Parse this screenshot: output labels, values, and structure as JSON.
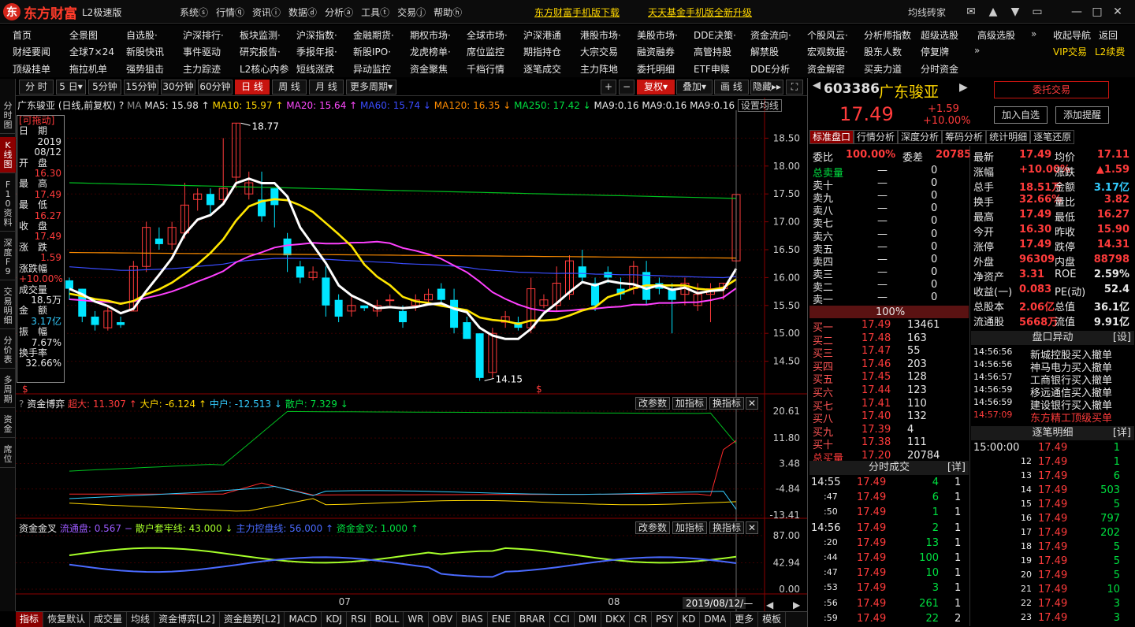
{
  "app": {
    "logo": "东方财富",
    "edition": "L2极速版",
    "menu": [
      "系统ⓢ",
      "行情ⓠ",
      "资讯ⓘ",
      "数据ⓓ",
      "分析ⓐ",
      "工具ⓣ",
      "交易ⓙ",
      "帮助ⓗ"
    ],
    "promo1": "东方财富手机版下载",
    "promo2": "天天基金手机版全新升级",
    "user": "均线砖家"
  },
  "menubar": {
    "row1": [
      "首页",
      "全景图",
      "自选股·",
      "沪深排行·",
      "板块监测·",
      "沪深指数·",
      "金融期货·",
      "期权市场·",
      "全球市场·",
      "沪深港通",
      "港股市场·",
      "美股市场·",
      "DDE决策·",
      "资金流向·",
      "个股风云·",
      "分析师指数",
      "超级选股",
      "高级选股"
    ],
    "row2": [
      "财经要闻",
      "全球7×24",
      "新股快讯",
      "事件驱动",
      "研究报告·",
      "季报年报·",
      "新股IPO·",
      "龙虎榜单·",
      "席位监控",
      "期指持仓",
      "大宗交易",
      "融资融券",
      "高管持股",
      "解禁股",
      "宏观数据·",
      "股东人数",
      "停复牌"
    ],
    "row3": [
      "顶级挂单",
      "拖拉机单",
      "强势狙击",
      "主力踪迹",
      "L2核心内参",
      "短线涨跌",
      "异动监控",
      "资金聚焦",
      "千档行情",
      "逐笔成交",
      "主力阵地",
      "委托明细",
      "ETF申赎",
      "DDE分析",
      "资金解密",
      "买卖力道",
      "分时资金"
    ],
    "right1": [
      "收起导航",
      "返回"
    ],
    "right2": [
      "VIP交易",
      "L2续费"
    ]
  },
  "lefttabs": [
    "分时图",
    "K线图",
    "F10资料",
    "深度F9",
    "交易明细",
    "分价表",
    "多周期",
    "资金",
    "席位"
  ],
  "periods": [
    "分 时",
    "5 日▾",
    "5分钟",
    "15分钟",
    "30分钟",
    "60分钟",
    "日 线",
    "周 线",
    "月 线",
    "更多周期▾"
  ],
  "chart_tools": {
    "plus": "+",
    "minus": "−",
    "fq": "复权▾",
    "overlay": "叠加▾",
    "grid": "画 线",
    "hide": "隐藏▸▸",
    "expand": "⛶"
  },
  "main_legend": {
    "name": "广东骏亚 (日线,前复权)",
    "q": "?",
    "ma": "MA",
    "ma5": "MA5: 15.98 ↑",
    "ma10": "MA10: 15.97 ↑",
    "ma20": "MA20: 15.64 ↑",
    "ma60": "MA60: 15.74 ↓",
    "ma120": "MA120: 16.35 ↓",
    "ma250": "MA250: 17.42 ↓",
    "ma9a": "MA9:0.16",
    "ma9b": "MA9:0.16",
    "ma9c": "MA9:0.16",
    "setting": "设置均线"
  },
  "datawin": {
    "drag": "[可拖动]",
    "date_l": "日　期",
    "date": "2019",
    "date2": "08/12",
    "open_l": "开　盘",
    "open": "16.30",
    "high_l": "最　高",
    "high": "17.49",
    "low_l": "最　低",
    "low": "16.27",
    "close_l": "收　盘",
    "close": "17.49",
    "chg_l": "涨　跌",
    "chg": "1.59",
    "pct_l": "涨跌幅",
    "pct": "+10.00%",
    "vol_l": "成交量",
    "vol": "18.5万",
    "amt_l": "金　额",
    "amt": "3.17亿",
    "amp_l": "振　幅",
    "amp": "7.67%",
    "turn_l": "换手率",
    "turn": "32.66%"
  },
  "price_axis": [
    "18.50",
    "18.00",
    "17.50",
    "17.00",
    "16.50",
    "16.00",
    "15.50",
    "15.00",
    "14.50"
  ],
  "annot": {
    "high": "18.77",
    "low": "14.15"
  },
  "sub1": {
    "title": "资金博弈",
    "q": "?",
    "big": "超大: 11.307 ↑",
    "large": "大户: -6.124 ↑",
    "mid": "中户: -12.513 ↓",
    "small": "散户: 7.329 ↓",
    "axis": [
      "20.61",
      "11.80",
      "3.48",
      "-4.84",
      "-13.41"
    ]
  },
  "sub2": {
    "title": "资金金叉",
    "flow": "流通盘: 0.567 −",
    "trap": "散户套牢线: 43.000 ↓",
    "ctrl": "主力控盘线: 56.000 ↑",
    "cross": "资金金叉: 1.000 ↑",
    "axis": [
      "87.00",
      "42.94",
      "0.00"
    ]
  },
  "sub_btns": [
    "改参数",
    "加指标",
    "换指标"
  ],
  "xaxis": {
    "m1": "07",
    "m2": "08",
    "date": "2019/08/12/—"
  },
  "bottom_tabs": [
    "指标",
    "恢复默认",
    "成交量",
    "均线",
    "资金博弈[L2]",
    "资金趋势[L2]",
    "MACD",
    "KDJ",
    "RSI",
    "BOLL",
    "WR",
    "OBV",
    "BIAS",
    "ENE",
    "BRAR",
    "CCI",
    "DMI",
    "DKX",
    "CR",
    "PSY",
    "KD",
    "DMA",
    "更多",
    "模板"
  ],
  "quote": {
    "code": "603386",
    "name": "广东骏亚",
    "price": "17.49",
    "chg": "+1.59",
    "pct": "+10.00%",
    "trade": "委托交易",
    "add": "加入自选",
    "alert": "添加提醒"
  },
  "quote_tabs": [
    "标准盘口",
    "行情分析",
    "深度分析",
    "筹码分析",
    "统计明细",
    "逐笔还原"
  ],
  "weibi": {
    "l": "委比",
    "v": "100.00%",
    "l2": "委差",
    "v2": "20785"
  },
  "asks": [
    {
      "l": "总卖量",
      "p": "—",
      "v": "0"
    },
    {
      "l": "卖十",
      "p": "—",
      "v": "0"
    },
    {
      "l": "卖九",
      "p": "—",
      "v": "0"
    },
    {
      "l": "卖八",
      "p": "—",
      "v": "0"
    },
    {
      "l": "卖七",
      "p": "—",
      "v": "0"
    },
    {
      "l": "卖六",
      "p": "—",
      "v": "0"
    },
    {
      "l": "卖五",
      "p": "—",
      "v": "0"
    },
    {
      "l": "卖四",
      "p": "—",
      "v": "0"
    },
    {
      "l": "卖三",
      "p": "—",
      "v": "0"
    },
    {
      "l": "卖二",
      "p": "—",
      "v": "0"
    },
    {
      "l": "卖一",
      "p": "—",
      "v": "0"
    }
  ],
  "ratio": "100%",
  "bids": [
    {
      "l": "买一",
      "p": "17.49",
      "v": "13461"
    },
    {
      "l": "买二",
      "p": "17.48",
      "v": "163"
    },
    {
      "l": "买三",
      "p": "17.47",
      "v": "55"
    },
    {
      "l": "买四",
      "p": "17.46",
      "v": "203"
    },
    {
      "l": "买五",
      "p": "17.45",
      "v": "128"
    },
    {
      "l": "买六",
      "p": "17.44",
      "v": "123"
    },
    {
      "l": "买七",
      "p": "17.41",
      "v": "110"
    },
    {
      "l": "买八",
      "p": "17.40",
      "v": "132"
    },
    {
      "l": "买九",
      "p": "17.39",
      "v": "4"
    },
    {
      "l": "买十",
      "p": "17.38",
      "v": "111"
    },
    {
      "l": "总买量",
      "p": "17.20",
      "v": "20784"
    }
  ],
  "stats": [
    [
      "最新",
      "17.49",
      "均价",
      "17.11"
    ],
    [
      "涨幅",
      "+10.00%",
      "涨跌",
      "▲1.59"
    ],
    [
      "总手",
      "18.51万",
      "金额",
      "3.17亿"
    ],
    [
      "换手",
      "32.66%",
      "量比",
      "3.82"
    ],
    [
      "最高",
      "17.49",
      "最低",
      "16.27"
    ],
    [
      "今开",
      "16.30",
      "昨收",
      "15.90"
    ],
    [
      "涨停",
      "17.49",
      "跌停",
      "14.31"
    ],
    [
      "外盘",
      "96309",
      "内盘",
      "88798"
    ],
    [
      "净资产",
      "3.31",
      "ROE",
      "2.59%"
    ],
    [
      "收益(一)",
      "0.083",
      "PE(动)",
      "52.4"
    ],
    [
      "总股本",
      "2.06亿",
      "总值",
      "36.1亿"
    ],
    [
      "流通股",
      "5668万",
      "流值",
      "9.91亿"
    ]
  ],
  "pankou": {
    "title": "盘口异动",
    "set": "[设]",
    "rows": [
      [
        "14:56:56",
        "新城控股",
        "买入撤单"
      ],
      [
        "14:56:56",
        "神马电力",
        "买入撤单"
      ],
      [
        "14:56:57",
        "工商银行",
        "买入撤单"
      ],
      [
        "14:56:59",
        "移远通信",
        "买入撤单"
      ],
      [
        "14:56:59",
        "建设银行",
        "买入撤单"
      ],
      [
        "14:57:09",
        "东方精工",
        "顶级买单"
      ]
    ]
  },
  "fenshi": {
    "title": "分时成交",
    "more": "[详]",
    "rows": [
      [
        "14:55",
        "17.49",
        "4",
        "1"
      ],
      [
        ":47",
        "17.49",
        "6",
        "1"
      ],
      [
        ":50",
        "17.49",
        "1",
        "1"
      ],
      [
        "14:56",
        "17.49",
        "2",
        "1"
      ],
      [
        ":20",
        "17.49",
        "13",
        "1"
      ],
      [
        ":44",
        "17.49",
        "100",
        "1"
      ],
      [
        ":47",
        "17.49",
        "10",
        "1"
      ],
      [
        ":53",
        "17.49",
        "3",
        "1"
      ],
      [
        ":56",
        "17.49",
        "261",
        "1"
      ],
      [
        ":59",
        "17.49",
        "22",
        "2"
      ]
    ]
  },
  "zhubi": {
    "title": "逐笔明细",
    "more": "[详]",
    "rows": [
      [
        "15:00:00",
        "17.49",
        "1"
      ],
      [
        "12",
        "17.49",
        "1"
      ],
      [
        "13",
        "17.49",
        "6"
      ],
      [
        "14",
        "17.49",
        "503"
      ],
      [
        "15",
        "17.49",
        "5"
      ],
      [
        "16",
        "17.49",
        "797"
      ],
      [
        "17",
        "17.49",
        "202"
      ],
      [
        "18",
        "17.49",
        "5"
      ],
      [
        "19",
        "17.49",
        "5"
      ],
      [
        "20",
        "17.49",
        "5"
      ],
      [
        "21",
        "17.49",
        "10"
      ],
      [
        "22",
        "17.49",
        "3"
      ],
      [
        "23",
        "17.49",
        "3"
      ]
    ]
  },
  "chart_data": {
    "type": "candlestick",
    "title": "广东骏亚 (日线,前复权)",
    "ylim": [
      14.0,
      19.0
    ],
    "candles": [
      [
        15.95,
        16.0,
        15.6,
        15.8
      ],
      [
        15.8,
        15.8,
        15.2,
        15.3
      ],
      [
        15.3,
        15.4,
        15.05,
        15.15
      ],
      [
        15.1,
        15.5,
        15.05,
        15.4
      ],
      [
        15.2,
        15.3,
        15.1,
        15.15
      ],
      [
        15.4,
        16.3,
        15.4,
        16.2
      ],
      [
        16.2,
        17.0,
        16.1,
        16.9
      ],
      [
        16.7,
        16.9,
        16.5,
        16.6
      ],
      [
        16.6,
        17.0,
        16.5,
        16.9
      ],
      [
        16.8,
        17.7,
        16.7,
        17.3
      ],
      [
        17.4,
        17.6,
        17.2,
        17.5
      ],
      [
        17.5,
        17.6,
        17.15,
        17.3
      ],
      [
        17.4,
        18.5,
        17.3,
        17.6
      ],
      [
        17.8,
        18.77,
        17.6,
        18.77
      ],
      [
        17.5,
        17.9,
        17.4,
        17.7
      ],
      [
        17.4,
        17.9,
        17.0,
        17.1
      ],
      [
        17.6,
        17.6,
        16.9,
        17.3
      ],
      [
        16.7,
        16.8,
        16.1,
        16.4
      ],
      [
        16.2,
        16.3,
        15.9,
        16.0
      ],
      [
        16.0,
        16.2,
        15.95,
        16.1
      ],
      [
        16.0,
        16.2,
        15.3,
        15.5
      ],
      [
        15.6,
        15.7,
        15.2,
        15.3
      ],
      [
        15.4,
        15.7,
        15.3,
        15.5
      ],
      [
        15.5,
        15.5,
        15.4,
        15.45
      ],
      [
        15.4,
        15.6,
        15.3,
        15.5
      ],
      [
        15.6,
        15.7,
        15.5,
        15.6
      ],
      [
        15.4,
        15.5,
        15.1,
        15.2
      ],
      [
        15.5,
        15.7,
        15.4,
        15.6
      ],
      [
        15.6,
        15.8,
        15.5,
        15.7
      ],
      [
        15.8,
        15.9,
        15.5,
        15.6
      ],
      [
        15.6,
        15.8,
        15.0,
        15.1
      ],
      [
        15.2,
        15.3,
        14.9,
        14.9
      ],
      [
        15.0,
        15.0,
        14.15,
        14.2
      ],
      [
        14.3,
        15.1,
        14.2,
        15.0
      ],
      [
        15.2,
        15.4,
        15.1,
        15.3
      ],
      [
        15.2,
        15.3,
        15.05,
        15.1
      ],
      [
        15.1,
        16.0,
        15.0,
        15.8
      ],
      [
        15.5,
        15.7,
        15.45,
        15.6
      ],
      [
        15.5,
        16.2,
        15.4,
        15.9
      ],
      [
        15.7,
        16.4,
        15.6,
        16.3
      ],
      [
        16.2,
        16.5,
        15.9,
        16.0
      ],
      [
        15.9,
        16.0,
        15.4,
        15.5
      ],
      [
        16.1,
        16.2,
        15.9,
        16.0
      ],
      [
        15.8,
        16.0,
        15.6,
        15.7
      ],
      [
        15.8,
        16.3,
        15.7,
        16.2
      ],
      [
        16.1,
        16.3,
        15.5,
        15.6
      ],
      [
        15.9,
        16.0,
        15.7,
        15.8
      ],
      [
        15.8,
        15.9,
        15.0,
        15.6
      ],
      [
        15.7,
        16.0,
        15.5,
        15.9
      ],
      [
        15.5,
        15.9,
        15.4,
        15.7
      ],
      [
        15.7,
        15.9,
        15.2,
        15.8
      ],
      [
        15.8,
        15.9,
        15.6,
        15.9
      ],
      [
        16.3,
        17.49,
        16.27,
        17.49
      ]
    ]
  }
}
